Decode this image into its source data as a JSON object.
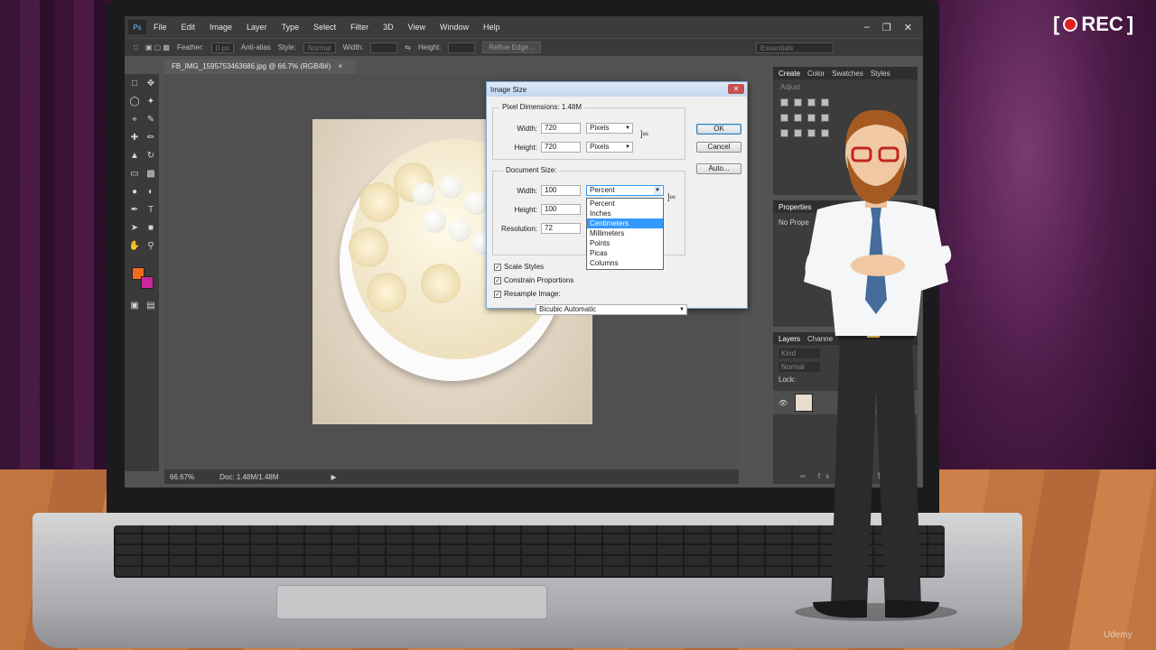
{
  "recording": {
    "label": "REC"
  },
  "watermark": {
    "label": "Udemy"
  },
  "photoshop": {
    "menu": [
      "File",
      "Edit",
      "Image",
      "Layer",
      "Type",
      "Select",
      "Filter",
      "3D",
      "View",
      "Window",
      "Help"
    ],
    "window_controls": {
      "minimize": "–",
      "restore": "❐",
      "close": "✕"
    },
    "options_bar": {
      "feather_label": "Feather:",
      "feather_value": "0 px",
      "antialias_label": "Anti-alias",
      "style_label": "Style:",
      "style_value": "Normal",
      "width_label": "Width:",
      "height_label": "Height:",
      "refine_edge": "Refine Edge...",
      "workspace": "Essentials"
    },
    "document_tab": "FB_IMG_1595753463686.jpg @ 66.7% (RGB/8#)",
    "status": {
      "zoom": "66.67%",
      "doc": "Doc: 1.48M/1.48M"
    },
    "panels": {
      "top_tabs": [
        "Create",
        "Color",
        "Swatches",
        "Styles"
      ],
      "adjust_label": "Adjust",
      "properties_tab": "Properties",
      "properties_text": "No Prope",
      "layers_tabs": [
        "Layers",
        "Channe"
      ],
      "kind_label": "Kind",
      "blend_mode": "Normal",
      "lock_label": "Lock:"
    }
  },
  "dialog": {
    "title": "Image Size",
    "close": "✕",
    "pixel_dimensions_label": "Pixel Dimensions:",
    "pixel_dimensions_value": "1.48M",
    "pixel_width_label": "Width:",
    "pixel_width_value": "720",
    "pixel_width_unit": "Pixels",
    "pixel_height_label": "Height:",
    "pixel_height_value": "720",
    "pixel_height_unit": "Pixels",
    "document_size_label": "Document Size:",
    "doc_width_label": "Width:",
    "doc_width_value": "100",
    "doc_width_unit": "Percent",
    "doc_height_label": "Height:",
    "doc_height_value": "100",
    "resolution_label": "Resolution:",
    "resolution_value": "72",
    "unit_options": [
      "Percent",
      "Inches",
      "Centimeters",
      "Millimeters",
      "Points",
      "Picas",
      "Columns"
    ],
    "selected_option_index": 2,
    "scale_styles": "Scale Styles",
    "constrain_proportions": "Constrain Proportions",
    "resample_image": "Resample Image:",
    "resample_method": "Bicubic Automatic",
    "ok_button": "OK",
    "cancel_button": "Cancel",
    "auto_button": "Auto..."
  }
}
